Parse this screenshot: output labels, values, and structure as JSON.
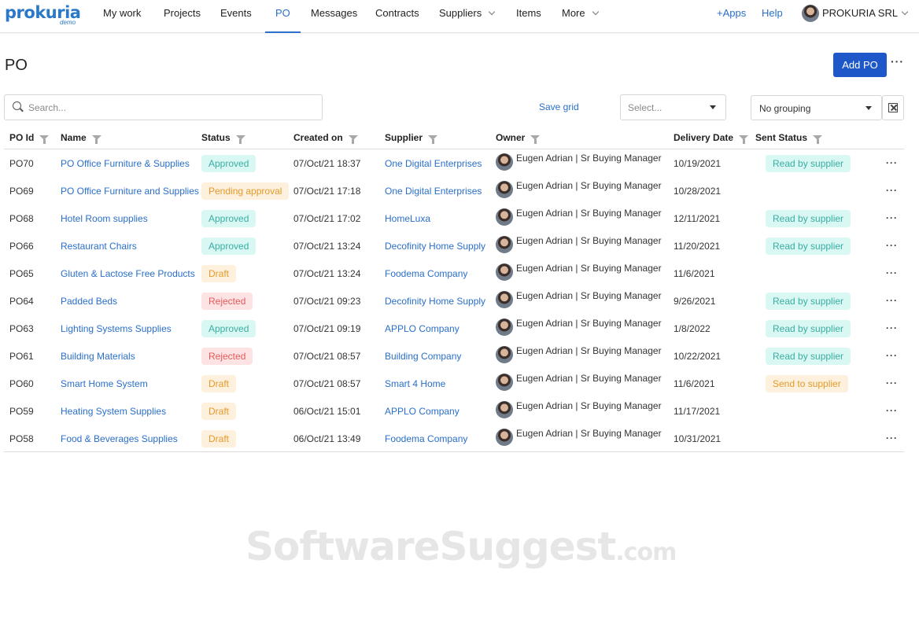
{
  "app": {
    "logo_text": "prokuria",
    "logo_sub": "demo"
  },
  "nav": {
    "items": [
      {
        "label": "My work"
      },
      {
        "label": "Projects"
      },
      {
        "label": "Events"
      },
      {
        "label": "PO"
      },
      {
        "label": "Messages"
      },
      {
        "label": "Contracts"
      },
      {
        "label": "Suppliers"
      },
      {
        "label": "Items"
      },
      {
        "label": "More"
      }
    ],
    "apps_label": "+Apps",
    "help_label": "Help",
    "account_label": "PROKURIA SRL"
  },
  "page": {
    "title": "PO",
    "add_label": "Add PO",
    "more_label": "···"
  },
  "toolbar": {
    "search_placeholder": "Search...",
    "save_grid_label": "Save grid",
    "select_placeholder": "Select...",
    "grouping_value": "No grouping"
  },
  "table": {
    "columns": [
      "PO Id",
      "Name",
      "Status",
      "Created on",
      "Supplier",
      "Owner",
      "Delivery Date",
      "Sent Status"
    ],
    "rows": [
      {
        "id": "PO70",
        "name": "PO Office Furniture & Supplies",
        "status": "Approved",
        "created": "07/Oct/21 18:37",
        "supplier": "One Digital Enterprises",
        "owner": "Eugen Adrian | Sr Buying Manager",
        "delivery": "10/19/2021",
        "sent": "Read by supplier"
      },
      {
        "id": "PO69",
        "name": "PO Office Furniture and Supplies",
        "status": "Pending approval",
        "created": "07/Oct/21 17:18",
        "supplier": "One Digital Enterprises",
        "owner": "Eugen Adrian | Sr Buying Manager",
        "delivery": "10/28/2021",
        "sent": ""
      },
      {
        "id": "PO68",
        "name": "Hotel Room supplies",
        "status": "Approved",
        "created": "07/Oct/21 17:02",
        "supplier": "HomeLuxa",
        "owner": "Eugen Adrian | Sr Buying Manager",
        "delivery": "12/11/2021",
        "sent": "Read by supplier"
      },
      {
        "id": "PO66",
        "name": "Restaurant Chairs",
        "status": "Approved",
        "created": "07/Oct/21 13:24",
        "supplier": "Decofinity Home Supply",
        "owner": "Eugen Adrian | Sr Buying Manager",
        "delivery": "11/20/2021",
        "sent": "Read by supplier"
      },
      {
        "id": "PO65",
        "name": "Gluten & Lactose Free Products",
        "status": "Draft",
        "created": "07/Oct/21 13:24",
        "supplier": "Foodema Company",
        "owner": "Eugen Adrian | Sr Buying Manager",
        "delivery": "11/6/2021",
        "sent": ""
      },
      {
        "id": "PO64",
        "name": "Padded Beds",
        "status": "Rejected",
        "created": "07/Oct/21 09:23",
        "supplier": "Decofinity Home Supply",
        "owner": "Eugen Adrian | Sr Buying Manager",
        "delivery": "9/26/2021",
        "sent": "Read by supplier"
      },
      {
        "id": "PO63",
        "name": "Lighting Systems Supplies",
        "status": "Approved",
        "created": "07/Oct/21 09:19",
        "supplier": "APPLO Company",
        "owner": "Eugen Adrian | Sr Buying Manager",
        "delivery": "1/8/2022",
        "sent": "Read by supplier"
      },
      {
        "id": "PO61",
        "name": "Building Materials",
        "status": "Rejected",
        "created": "07/Oct/21 08:57",
        "supplier": "Building Company",
        "owner": "Eugen Adrian | Sr Buying Manager",
        "delivery": "10/22/2021",
        "sent": "Read by supplier"
      },
      {
        "id": "PO60",
        "name": "Smart Home System",
        "status": "Draft",
        "created": "07/Oct/21 08:57",
        "supplier": "Smart 4 Home",
        "owner": "Eugen Adrian | Sr Buying Manager",
        "delivery": "11/6/2021",
        "sent": "Send to supplier"
      },
      {
        "id": "PO59",
        "name": "Heating System Supplies",
        "status": "Draft",
        "created": "06/Oct/21 15:01",
        "supplier": "APPLO Company",
        "owner": "Eugen Adrian | Sr Buying Manager",
        "delivery": "11/17/2021",
        "sent": ""
      },
      {
        "id": "PO58",
        "name": "Food & Beverages Supplies",
        "status": "Draft",
        "created": "06/Oct/21 13:49",
        "supplier": "Foodema Company",
        "owner": "Eugen Adrian | Sr Buying Manager",
        "delivery": "10/31/2021",
        "sent": ""
      }
    ],
    "row_more_label": "···"
  },
  "watermark": {
    "main": "SoftwareSuggest",
    "suffix": ".com"
  },
  "colors": {
    "accent": "#1e58c8",
    "link": "#2a6fc9",
    "approved_bg": "#d9f7f3",
    "approved_fg": "#3aaea3",
    "draft_bg": "#fdf0dc",
    "draft_fg": "#e49a2c",
    "rejected_bg": "#fde3e3",
    "rejected_fg": "#e55a5a"
  }
}
